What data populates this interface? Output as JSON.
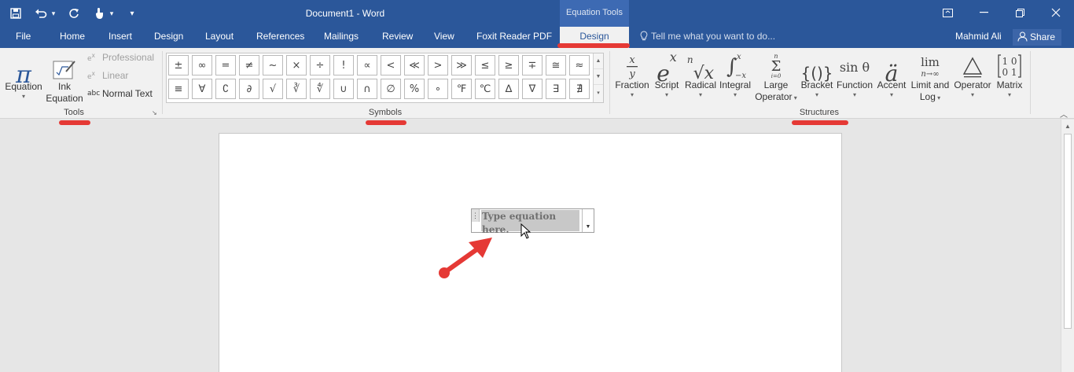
{
  "titlebar": {
    "document_title": "Document1 - Word",
    "context_group": "Equation Tools",
    "qat": [
      "save-icon",
      "undo-icon",
      "redo-icon",
      "touch-mode-icon",
      "customize-icon"
    ]
  },
  "tabs": {
    "items": [
      "File",
      "Home",
      "Insert",
      "Design",
      "Layout",
      "References",
      "Mailings",
      "Review",
      "View",
      "Foxit Reader PDF"
    ],
    "active": "Design",
    "tell_me": "Tell me what you want to do...",
    "user": "Mahmid Ali",
    "share": "Share"
  },
  "tools": {
    "equation": "Equation",
    "ink_line1": "Ink",
    "ink_line2": "Equation",
    "professional": "Professional",
    "linear": "Linear",
    "normal_text": "Normal Text",
    "normal_text_icon": "abc",
    "label": "Tools"
  },
  "symbols": {
    "items": [
      "±",
      "∞",
      "=",
      "≠",
      "~",
      "×",
      "÷",
      "!",
      "∝",
      "<",
      "≪",
      ">",
      "≫",
      "≤",
      "≥",
      "∓",
      "≅",
      "≈",
      "≡",
      "∀",
      "∁",
      "∂",
      "√",
      "∛",
      "∜",
      "∪",
      "∩",
      "∅",
      "%",
      "∘",
      "℉",
      "℃",
      "∆",
      "∇",
      "∃",
      "∄"
    ],
    "label": "Symbols"
  },
  "structures": {
    "fraction": "Fraction",
    "script": "Script",
    "radical": "Radical",
    "integral": "Integral",
    "large_line1": "Large",
    "large_line2": "Operator",
    "bracket": "Bracket",
    "function": "Function",
    "accent": "Accent",
    "limit_line1": "Limit and",
    "limit_line2": "Log",
    "operator": "Operator",
    "matrix": "Matrix",
    "label": "Structures"
  },
  "document": {
    "equation_placeholder": "Type equation here."
  }
}
